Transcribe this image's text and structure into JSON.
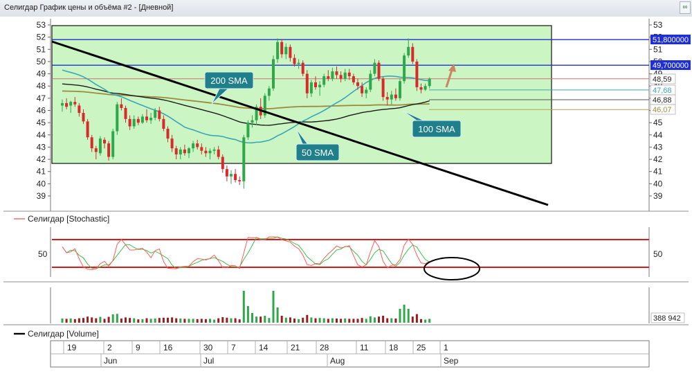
{
  "window": {
    "title": "Селигдар График цены и объёма #2 - [Дневной]",
    "corner_icon": "link-icon"
  },
  "colors": {
    "panel_bg": "#ccf5c4",
    "up": "#2ea84a",
    "down": "#d62b2b",
    "sma50": "#3aa6b5",
    "sma100": "#1a1a1a",
    "sma200": "#9c8b3e",
    "trend": "#000000",
    "level": "#1f2fd6",
    "stoch_band": "#e01818",
    "stoch_k": "#ff5b5b",
    "stoch_d": "#38c24a",
    "arrow": "#c98660"
  },
  "price_axis": {
    "ticks": [
      "53",
      "52",
      "51",
      "50",
      "49",
      "48",
      "47",
      "46",
      "45",
      "44",
      "43",
      "42",
      "41",
      "40",
      "39"
    ]
  },
  "price_badges": {
    "level_high": "51,800000",
    "level_low": "49,700000",
    "last": "48,59",
    "sma50": "47,68",
    "sma100": "46,88",
    "sma200": "46,07"
  },
  "annotations": {
    "sma200": "200 SMA",
    "sma50": "50 SMA",
    "sma100": "100 SMA"
  },
  "stochastic": {
    "legend": "Селигдар [Stochastic]",
    "tick": "50"
  },
  "volume": {
    "legend": "Селигдар [Volume]",
    "last": "388 942"
  },
  "time_axis": {
    "days": [
      "19",
      "2",
      "9",
      "16",
      "30",
      "7",
      "14",
      "21",
      "28",
      "11",
      "18",
      "25",
      "1"
    ],
    "months": [
      "Jun",
      "Jul",
      "Aug",
      "Sep"
    ]
  },
  "chart_data": {
    "type": "candlestick",
    "title": "Селигдар График цены и объёма #2 - [Дневной]",
    "price_range": [
      38.3,
      53.2
    ],
    "levels": [
      51.8,
      49.7
    ],
    "last_price": 48.59,
    "sma": {
      "sma50": 47.68,
      "sma100": 46.88,
      "sma200": 46.07
    },
    "candles": [
      {
        "o": 46.4,
        "h": 46.9,
        "l": 45.9,
        "c": 46.6
      },
      {
        "o": 46.6,
        "h": 47.0,
        "l": 46.1,
        "c": 46.3
      },
      {
        "o": 46.4,
        "h": 46.8,
        "l": 45.8,
        "c": 46.7
      },
      {
        "o": 46.7,
        "h": 47.1,
        "l": 46.3,
        "c": 46.5
      },
      {
        "o": 46.4,
        "h": 46.6,
        "l": 45.5,
        "c": 45.8
      },
      {
        "o": 45.8,
        "h": 46.1,
        "l": 44.9,
        "c": 45.1
      },
      {
        "o": 45.1,
        "h": 45.3,
        "l": 43.6,
        "c": 43.8
      },
      {
        "o": 43.8,
        "h": 44.0,
        "l": 42.6,
        "c": 42.9
      },
      {
        "o": 42.9,
        "h": 43.1,
        "l": 42.0,
        "c": 42.6
      },
      {
        "o": 42.5,
        "h": 43.9,
        "l": 42.3,
        "c": 43.7
      },
      {
        "o": 43.6,
        "h": 43.8,
        "l": 42.9,
        "c": 43.3
      },
      {
        "o": 43.3,
        "h": 43.5,
        "l": 41.9,
        "c": 42.2
      },
      {
        "o": 42.2,
        "h": 44.5,
        "l": 42.0,
        "c": 44.3
      },
      {
        "o": 44.3,
        "h": 46.7,
        "l": 44.0,
        "c": 46.5
      },
      {
        "o": 46.5,
        "h": 47.0,
        "l": 46.0,
        "c": 46.2
      },
      {
        "o": 46.2,
        "h": 46.4,
        "l": 45.0,
        "c": 45.3
      },
      {
        "o": 45.3,
        "h": 45.6,
        "l": 44.4,
        "c": 44.7
      },
      {
        "o": 44.7,
        "h": 45.6,
        "l": 44.5,
        "c": 45.3
      },
      {
        "o": 45.3,
        "h": 45.5,
        "l": 44.8,
        "c": 45.0
      },
      {
        "o": 45.0,
        "h": 45.7,
        "l": 44.9,
        "c": 45.5
      },
      {
        "o": 45.5,
        "h": 46.1,
        "l": 45.0,
        "c": 45.2
      },
      {
        "o": 45.2,
        "h": 45.8,
        "l": 44.9,
        "c": 45.4
      },
      {
        "o": 45.4,
        "h": 46.2,
        "l": 45.2,
        "c": 46.0
      },
      {
        "o": 46.0,
        "h": 46.3,
        "l": 45.1,
        "c": 45.3
      },
      {
        "o": 45.3,
        "h": 45.6,
        "l": 44.3,
        "c": 44.5
      },
      {
        "o": 44.5,
        "h": 44.7,
        "l": 43.4,
        "c": 43.7
      },
      {
        "o": 43.7,
        "h": 44.0,
        "l": 42.6,
        "c": 42.9
      },
      {
        "o": 42.9,
        "h": 43.1,
        "l": 42.0,
        "c": 42.4
      },
      {
        "o": 42.4,
        "h": 43.0,
        "l": 42.0,
        "c": 42.8
      },
      {
        "o": 42.8,
        "h": 43.2,
        "l": 42.3,
        "c": 42.5
      },
      {
        "o": 42.5,
        "h": 43.0,
        "l": 42.1,
        "c": 42.9
      },
      {
        "o": 42.9,
        "h": 43.5,
        "l": 42.6,
        "c": 43.3
      },
      {
        "o": 43.3,
        "h": 43.6,
        "l": 42.8,
        "c": 43.0
      },
      {
        "o": 43.0,
        "h": 43.3,
        "l": 42.4,
        "c": 42.7
      },
      {
        "o": 42.7,
        "h": 43.0,
        "l": 42.2,
        "c": 42.5
      },
      {
        "o": 42.5,
        "h": 42.9,
        "l": 42.0,
        "c": 42.7
      },
      {
        "o": 42.7,
        "h": 43.0,
        "l": 42.4,
        "c": 42.8
      },
      {
        "o": 42.8,
        "h": 43.1,
        "l": 42.0,
        "c": 42.2
      },
      {
        "o": 42.2,
        "h": 42.4,
        "l": 40.9,
        "c": 41.2
      },
      {
        "o": 41.2,
        "h": 41.5,
        "l": 40.2,
        "c": 40.6
      },
      {
        "o": 40.6,
        "h": 41.1,
        "l": 40.0,
        "c": 40.8
      },
      {
        "o": 40.8,
        "h": 41.2,
        "l": 40.1,
        "c": 40.3
      },
      {
        "o": 40.3,
        "h": 40.6,
        "l": 39.9,
        "c": 40.2
      },
      {
        "o": 40.2,
        "h": 44.0,
        "l": 39.6,
        "c": 43.8
      },
      {
        "o": 43.8,
        "h": 45.2,
        "l": 43.6,
        "c": 45.0
      },
      {
        "o": 45.0,
        "h": 45.6,
        "l": 44.6,
        "c": 45.2
      },
      {
        "o": 45.2,
        "h": 46.5,
        "l": 44.8,
        "c": 46.3
      },
      {
        "o": 46.3,
        "h": 47.0,
        "l": 45.3,
        "c": 45.6
      },
      {
        "o": 45.6,
        "h": 47.4,
        "l": 45.4,
        "c": 47.2
      },
      {
        "o": 47.2,
        "h": 48.0,
        "l": 46.8,
        "c": 47.8
      },
      {
        "o": 47.8,
        "h": 50.5,
        "l": 47.6,
        "c": 50.2
      },
      {
        "o": 50.2,
        "h": 51.9,
        "l": 49.9,
        "c": 51.6
      },
      {
        "o": 51.6,
        "h": 51.8,
        "l": 50.3,
        "c": 50.6
      },
      {
        "o": 50.6,
        "h": 51.5,
        "l": 50.2,
        "c": 51.2
      },
      {
        "o": 51.2,
        "h": 51.4,
        "l": 50.0,
        "c": 50.3
      },
      {
        "o": 50.3,
        "h": 50.6,
        "l": 49.6,
        "c": 49.8
      },
      {
        "o": 49.8,
        "h": 50.2,
        "l": 49.4,
        "c": 49.9
      },
      {
        "o": 49.9,
        "h": 50.1,
        "l": 48.8,
        "c": 49.0
      },
      {
        "o": 49.0,
        "h": 49.3,
        "l": 47.0,
        "c": 47.4
      },
      {
        "o": 47.4,
        "h": 48.5,
        "l": 47.1,
        "c": 48.3
      },
      {
        "o": 48.3,
        "h": 48.8,
        "l": 47.7,
        "c": 47.9
      },
      {
        "o": 47.9,
        "h": 48.4,
        "l": 47.2,
        "c": 48.1
      },
      {
        "o": 48.1,
        "h": 49.0,
        "l": 47.9,
        "c": 48.8
      },
      {
        "o": 48.8,
        "h": 49.3,
        "l": 48.4,
        "c": 48.6
      },
      {
        "o": 48.6,
        "h": 49.5,
        "l": 48.4,
        "c": 49.2
      },
      {
        "o": 49.2,
        "h": 49.6,
        "l": 48.6,
        "c": 48.9
      },
      {
        "o": 48.9,
        "h": 49.2,
        "l": 48.3,
        "c": 48.6
      },
      {
        "o": 48.6,
        "h": 49.4,
        "l": 48.4,
        "c": 49.1
      },
      {
        "o": 49.1,
        "h": 49.4,
        "l": 48.5,
        "c": 48.8
      },
      {
        "o": 48.8,
        "h": 49.0,
        "l": 48.1,
        "c": 48.3
      },
      {
        "o": 48.3,
        "h": 48.6,
        "l": 47.7,
        "c": 48.0
      },
      {
        "o": 48.0,
        "h": 48.3,
        "l": 47.1,
        "c": 47.4
      },
      {
        "o": 47.4,
        "h": 47.9,
        "l": 47.0,
        "c": 47.7
      },
      {
        "o": 47.7,
        "h": 49.3,
        "l": 47.5,
        "c": 49.0
      },
      {
        "o": 49.0,
        "h": 50.2,
        "l": 48.8,
        "c": 49.9
      },
      {
        "o": 49.9,
        "h": 50.1,
        "l": 48.4,
        "c": 48.6
      },
      {
        "o": 48.6,
        "h": 48.8,
        "l": 46.8,
        "c": 47.1
      },
      {
        "o": 47.1,
        "h": 47.5,
        "l": 46.4,
        "c": 46.9
      },
      {
        "o": 46.9,
        "h": 47.6,
        "l": 46.5,
        "c": 47.3
      },
      {
        "o": 47.3,
        "h": 47.8,
        "l": 46.8,
        "c": 47.0
      },
      {
        "o": 47.0,
        "h": 48.6,
        "l": 46.8,
        "c": 48.4
      },
      {
        "o": 48.4,
        "h": 50.7,
        "l": 48.2,
        "c": 50.5
      },
      {
        "o": 50.5,
        "h": 51.9,
        "l": 50.3,
        "c": 51.2
      },
      {
        "o": 51.2,
        "h": 51.5,
        "l": 49.8,
        "c": 50.0
      },
      {
        "o": 50.0,
        "h": 50.2,
        "l": 47.6,
        "c": 47.9
      },
      {
        "o": 47.9,
        "h": 48.2,
        "l": 47.4,
        "c": 47.7
      },
      {
        "o": 47.7,
        "h": 48.2,
        "l": 47.6,
        "c": 48.0
      },
      {
        "o": 48.0,
        "h": 48.7,
        "l": 47.8,
        "c": 48.6
      }
    ],
    "volume_last": "388 942"
  }
}
